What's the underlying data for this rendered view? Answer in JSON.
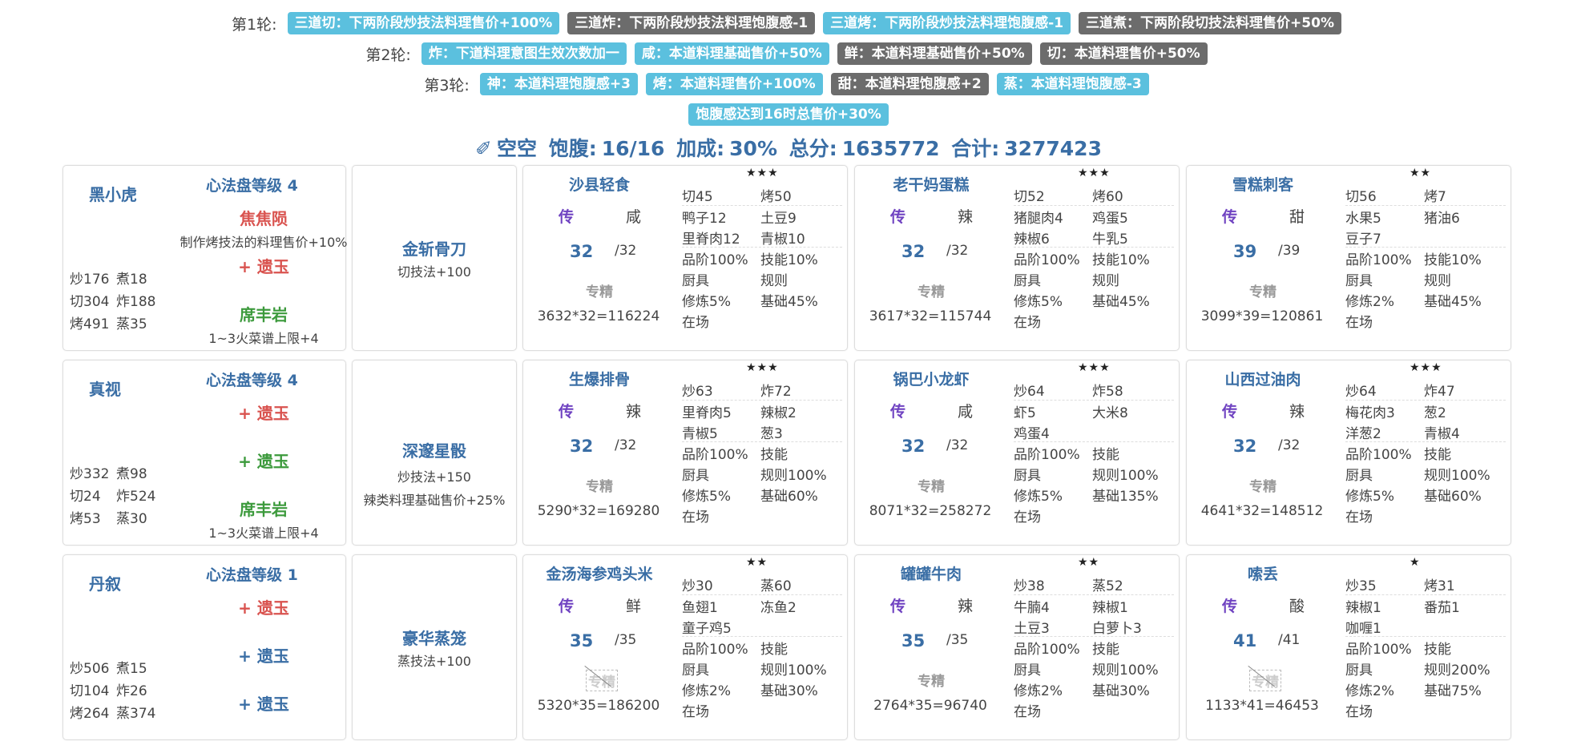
{
  "rounds": [
    {
      "label": "第1轮:",
      "badges": [
        {
          "text": "三道切：下两阶段炒技法料理售价+100%",
          "color": "blue"
        },
        {
          "text": "三道炸：下两阶段炒技法料理饱腹感-1",
          "color": "gray"
        },
        {
          "text": "三道烤：下两阶段炒技法料理饱腹感-1",
          "color": "blue"
        },
        {
          "text": "三道煮：下两阶段切技法料理售价+50%",
          "color": "gray"
        }
      ]
    },
    {
      "label": "第2轮:",
      "badges": [
        {
          "text": "炸：下道料理意图生效次数加一",
          "color": "blue"
        },
        {
          "text": "咸：本道料理基础售价+50%",
          "color": "blue"
        },
        {
          "text": "鲜：本道料理基础售价+50%",
          "color": "gray"
        },
        {
          "text": "切：本道料理售价+50%",
          "color": "gray"
        }
      ]
    },
    {
      "label": "第3轮:",
      "badges": [
        {
          "text": "神：本道料理饱腹感+3",
          "color": "blue"
        },
        {
          "text": "烤：本道料理售价+100%",
          "color": "blue"
        },
        {
          "text": "甜：本道料理饱腹感+2",
          "color": "gray"
        },
        {
          "text": "蒸：本道料理饱腹感-3",
          "color": "blue"
        }
      ]
    },
    {
      "label": "",
      "badges": [
        {
          "text": "饱腹感达到16时总售价+30%",
          "color": "blue"
        }
      ]
    }
  ],
  "summary": {
    "icon": "✐",
    "name": "空空",
    "full_label": "饱腹:",
    "full_value": "16/16",
    "bonus_label": "加成:",
    "bonus_value": "30%",
    "score_label": "总分:",
    "score_value": "1635772",
    "total_label": "合计:",
    "total_value": "3277423"
  },
  "rows": [
    {
      "chef": {
        "name": "黑小虎",
        "disk": "心法盘等级 4",
        "auras": [
          {
            "text": "焦焦陨",
            "color": "red"
          },
          {
            "text": "+ 遗玉",
            "color": "red"
          },
          {
            "text": "席丰岩",
            "color": "green"
          }
        ],
        "aura_desc": [
          "制作烤技法的料理售价+10%",
          "1~3火菜谱上限+4"
        ],
        "skills": [
          [
            "炒176",
            "煮18"
          ],
          [
            "切304",
            "炸188"
          ],
          [
            "烤491",
            "蒸35"
          ]
        ]
      },
      "equip": {
        "name": "金斩骨刀",
        "desc": [
          "切技法+100"
        ]
      },
      "dishes": [
        {
          "stars": "★★★",
          "name": "沙县轻食",
          "rarity": "传",
          "flavor": "咸",
          "qty": "32",
          "qtymax": "/32",
          "spec": "专精",
          "spec_active": true,
          "formula": "3632*32=116224",
          "skills": [
            [
              "切45",
              "烤50"
            ]
          ],
          "ings": [
            [
              "鸭子12",
              "土豆9"
            ],
            [
              "里脊肉12",
              "青椒10"
            ]
          ],
          "info": [
            [
              "品阶100%",
              "技能10%"
            ],
            [
              "厨具",
              "规则"
            ],
            [
              "修炼5%",
              "基础45%"
            ],
            [
              "在场",
              ""
            ]
          ]
        },
        {
          "stars": "★★★",
          "name": "老干妈蛋糕",
          "rarity": "传",
          "flavor": "辣",
          "qty": "32",
          "qtymax": "/32",
          "spec": "专精",
          "spec_active": true,
          "formula": "3617*32=115744",
          "skills": [
            [
              "切52",
              "烤60"
            ]
          ],
          "ings": [
            [
              "猪腿肉4",
              "鸡蛋5"
            ],
            [
              "辣椒6",
              "牛乳5"
            ]
          ],
          "info": [
            [
              "品阶100%",
              "技能10%"
            ],
            [
              "厨具",
              "规则"
            ],
            [
              "修炼5%",
              "基础45%"
            ],
            [
              "在场",
              ""
            ]
          ]
        },
        {
          "stars": "★★",
          "name": "雪糕刺客",
          "rarity": "传",
          "flavor": "甜",
          "qty": "39",
          "qtymax": "/39",
          "spec": "专精",
          "spec_active": true,
          "formula": "3099*39=120861",
          "skills": [
            [
              "切56",
              "烤7"
            ]
          ],
          "ings": [
            [
              "水果5",
              "猪油6"
            ],
            [
              "豆子7",
              ""
            ]
          ],
          "info": [
            [
              "品阶100%",
              "技能10%"
            ],
            [
              "厨具",
              "规则"
            ],
            [
              "修炼2%",
              "基础45%"
            ],
            [
              "在场",
              ""
            ]
          ]
        }
      ]
    },
    {
      "chef": {
        "name": "真视",
        "disk": "心法盘等级 4",
        "auras": [
          {
            "text": "+ 遗玉",
            "color": "red"
          },
          {
            "text": "+ 遗玉",
            "color": "green"
          },
          {
            "text": "席丰岩",
            "color": "green"
          }
        ],
        "aura_desc": [
          "",
          "1~3火菜谱上限+4"
        ],
        "skills": [
          [
            "炒332",
            "煮98"
          ],
          [
            "切24",
            "炸524"
          ],
          [
            "烤53",
            "蒸30"
          ]
        ]
      },
      "equip": {
        "name": "深邃星骰",
        "desc": [
          "炒技法+150",
          "辣类料理基础售价+25%"
        ]
      },
      "dishes": [
        {
          "stars": "★★★",
          "name": "生爆排骨",
          "rarity": "传",
          "flavor": "辣",
          "qty": "32",
          "qtymax": "/32",
          "spec": "专精",
          "spec_active": true,
          "formula": "5290*32=169280",
          "skills": [
            [
              "炒63",
              "炸72"
            ]
          ],
          "ings": [
            [
              "里脊肉5",
              "辣椒2"
            ],
            [
              "青椒5",
              "葱3"
            ]
          ],
          "info": [
            [
              "品阶100%",
              "技能"
            ],
            [
              "厨具",
              "规则100%"
            ],
            [
              "修炼5%",
              "基础60%"
            ],
            [
              "在场",
              ""
            ]
          ]
        },
        {
          "stars": "★★★",
          "name": "锅巴小龙虾",
          "rarity": "传",
          "flavor": "咸",
          "qty": "32",
          "qtymax": "/32",
          "spec": "专精",
          "spec_active": true,
          "formula": "8071*32=258272",
          "skills": [
            [
              "炒64",
              "炸58"
            ]
          ],
          "ings": [
            [
              "虾5",
              "大米8"
            ],
            [
              "鸡蛋4",
              ""
            ]
          ],
          "info": [
            [
              "品阶100%",
              "技能"
            ],
            [
              "厨具",
              "规则100%"
            ],
            [
              "修炼5%",
              "基础135%"
            ],
            [
              "在场",
              ""
            ]
          ]
        },
        {
          "stars": "★★★",
          "name": "山西过油肉",
          "rarity": "传",
          "flavor": "辣",
          "qty": "32",
          "qtymax": "/32",
          "spec": "专精",
          "spec_active": true,
          "formula": "4641*32=148512",
          "skills": [
            [
              "炒64",
              "炸47"
            ]
          ],
          "ings": [
            [
              "梅花肉3",
              "葱2"
            ],
            [
              "洋葱2",
              "青椒4"
            ]
          ],
          "info": [
            [
              "品阶100%",
              "技能"
            ],
            [
              "厨具",
              "规则100%"
            ],
            [
              "修炼5%",
              "基础60%"
            ],
            [
              "在场",
              ""
            ]
          ]
        }
      ]
    },
    {
      "chef": {
        "name": "丹叙",
        "disk": "心法盘等级 1",
        "auras": [
          {
            "text": "+ 遗玉",
            "color": "red"
          },
          {
            "text": "+ 遗玉",
            "color": "blue"
          },
          {
            "text": "+ 遗玉",
            "color": "blue"
          }
        ],
        "aura_desc": [
          "",
          ""
        ],
        "skills": [
          [
            "炒506",
            "煮15"
          ],
          [
            "切104",
            "炸26"
          ],
          [
            "烤264",
            "蒸374"
          ]
        ]
      },
      "equip": {
        "name": "豪华蒸笼",
        "desc": [
          "蒸技法+100"
        ]
      },
      "dishes": [
        {
          "stars": "★★",
          "name": "金汤海参鸡头米",
          "rarity": "传",
          "flavor": "鲜",
          "qty": "35",
          "qtymax": "/35",
          "spec": "专精",
          "spec_active": false,
          "formula": "5320*35=186200",
          "skills": [
            [
              "炒30",
              "蒸60"
            ]
          ],
          "ings": [
            [
              "鱼翅1",
              "冻鱼2"
            ],
            [
              "童子鸡5",
              ""
            ]
          ],
          "info": [
            [
              "品阶100%",
              "技能"
            ],
            [
              "厨具",
              "规则100%"
            ],
            [
              "修炼2%",
              "基础30%"
            ],
            [
              "在场",
              ""
            ]
          ]
        },
        {
          "stars": "★★",
          "name": "罐罐牛肉",
          "rarity": "传",
          "flavor": "辣",
          "qty": "35",
          "qtymax": "/35",
          "spec": "专精",
          "spec_active": true,
          "formula": "2764*35=96740",
          "skills": [
            [
              "炒38",
              "蒸52"
            ]
          ],
          "ings": [
            [
              "牛腩4",
              "辣椒1"
            ],
            [
              "土豆3",
              "白萝卜3"
            ]
          ],
          "info": [
            [
              "品阶100%",
              "技能"
            ],
            [
              "厨具",
              "规则100%"
            ],
            [
              "修炼2%",
              "基础30%"
            ],
            [
              "在场",
              ""
            ]
          ]
        },
        {
          "stars": "★",
          "name": "嗦丢",
          "rarity": "传",
          "flavor": "酸",
          "qty": "41",
          "qtymax": "/41",
          "spec": "专精",
          "spec_active": false,
          "formula": "1133*41=46453",
          "skills": [
            [
              "炒35",
              "烤31"
            ]
          ],
          "ings": [
            [
              "辣椒1",
              "番茄1"
            ],
            [
              "咖喱1",
              ""
            ]
          ],
          "info": [
            [
              "品阶100%",
              "技能"
            ],
            [
              "厨具",
              "规则200%"
            ],
            [
              "修炼2%",
              "基础75%"
            ],
            [
              "在场",
              ""
            ]
          ]
        }
      ]
    }
  ]
}
